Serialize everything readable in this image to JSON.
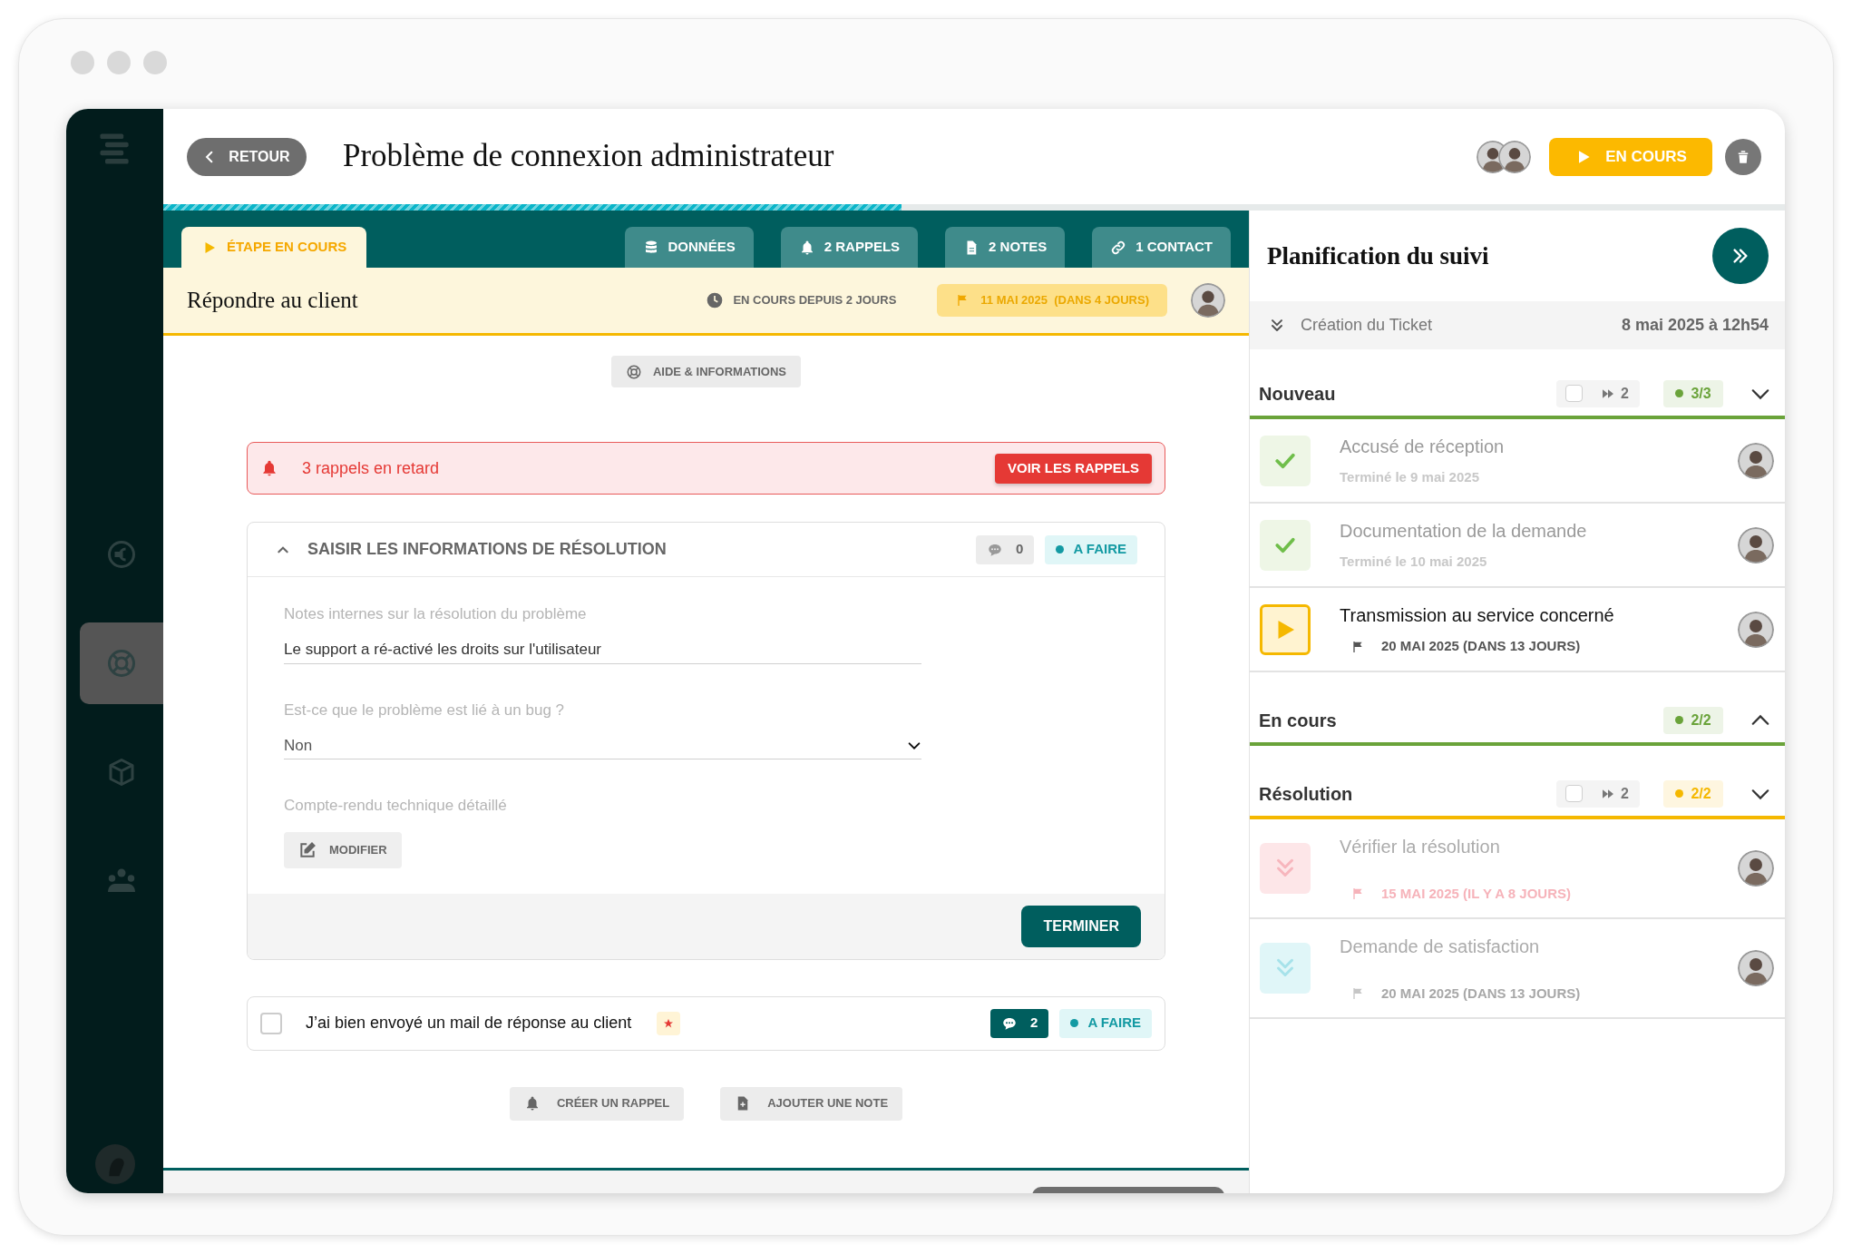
{
  "sidebar": {
    "items": [
      {
        "kind": "currency",
        "selected": false
      },
      {
        "kind": "lifebuoy",
        "selected": true
      },
      {
        "kind": "cube",
        "selected": false
      },
      {
        "kind": "team",
        "selected": false
      }
    ]
  },
  "header": {
    "back_label": "RETOUR",
    "title": "Problème de connexion administrateur",
    "status_label": "EN COURS",
    "progress": {
      "level": 0.455
    }
  },
  "step_tabs": [
    {
      "kind": "play",
      "label": "ÉTAPE EN COURS",
      "selected": true
    },
    {
      "kind": "database",
      "label": "DONNÉES",
      "selected": false
    },
    {
      "kind": "bell",
      "label": "2 RAPPELS",
      "selected": false
    },
    {
      "kind": "file",
      "label": "2 NOTES",
      "selected": false
    },
    {
      "kind": "link",
      "label": "1 CONTACT",
      "selected": false
    }
  ],
  "step": {
    "title": "Répondre au client",
    "since": "EN COURS DEPUIS 2 JOURS",
    "due": "11 MAI 2025  (DANS 4 JOURS)"
  },
  "help_button": "AIDE & INFORMATIONS",
  "alert": {
    "text": "3 rappels en retard",
    "button": "VOIR LES RAPPELS"
  },
  "task_card": {
    "title": "SAISIR LES INFORMATIONS DE RÉSOLUTION",
    "expanded": true,
    "comments": {
      "count": "0",
      "active": false
    },
    "status": "A FAIRE",
    "fields": [
      {
        "kind": "text",
        "label": "Notes internes sur la résolution du problème",
        "value": "Le support a ré-activé les droits sur l'utilisateur"
      },
      {
        "kind": "select",
        "label": "Est-ce que le problème est lié à un bug ?",
        "value": "Non"
      },
      {
        "kind": "rich",
        "label": "Compte-rendu technique détaillé",
        "button": "MODIFIER"
      }
    ],
    "submit": "TERMINER"
  },
  "checklist": [
    {
      "text": "J’ai bien envoyé un mail de réponse au client",
      "checked": false,
      "required": true,
      "comments": {
        "count": "2",
        "active": true
      },
      "status": "A FAIRE"
    }
  ],
  "actions": [
    {
      "kind": "bell",
      "label": "CRÉER UN RAPPEL"
    },
    {
      "kind": "note",
      "label": "AJOUTER UNE NOTE"
    }
  ],
  "planning": {
    "title": "Planification du suivi",
    "creation": {
      "label": "Création du Ticket",
      "date": "8 mai 2025 à 12h54"
    },
    "phases": [
      {
        "name": "Nouveau",
        "color": "#6aa33a",
        "expanded": true,
        "skip_checked": false,
        "skip_count": "2",
        "progress": "3/3",
        "steps": [
          {
            "kind": "done",
            "title": "Accusé de réception",
            "meta": "Terminé le 9 mai 2025"
          },
          {
            "kind": "done",
            "title": "Documentation de la demande",
            "meta": "Terminé le 10 mai 2025"
          },
          {
            "kind": "active",
            "title": "Transmission au service concerné",
            "meta": "20 MAI 2025 (DANS 13 JOURS)"
          }
        ]
      },
      {
        "name": "En cours",
        "color": "#6aa33a",
        "expanded": false,
        "progress": "2/2"
      },
      {
        "name": "Résolution",
        "color": "#f5b800",
        "expanded": true,
        "skip_checked": false,
        "skip_count": "2",
        "progress": "2/2",
        "steps": [
          {
            "kind": "overdue",
            "title": "Vérifier la résolution",
            "meta": "15 MAI 2025 (IL Y A 8 JOURS)"
          },
          {
            "kind": "upcoming",
            "title": "Demande de satisfaction",
            "meta": "20 MAI 2025 (DANS 13 JOURS)"
          }
        ]
      }
    ]
  }
}
